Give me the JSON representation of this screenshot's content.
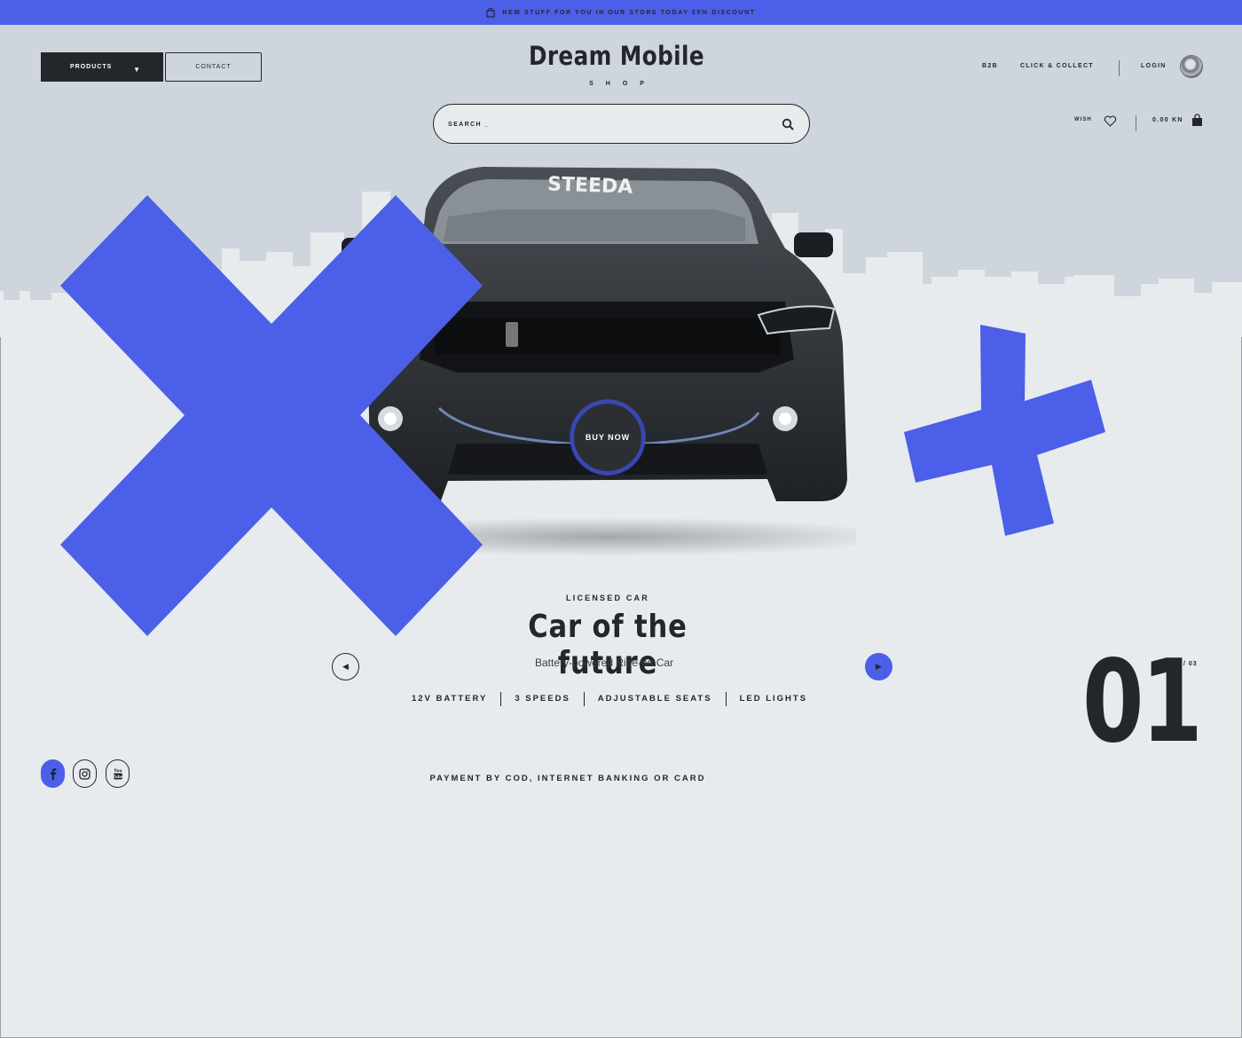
{
  "promo": {
    "text": "NEW STUFF FOR YOU IN OUR STORE TODAY 25% DISCOUNT",
    "icon": "bag-icon"
  },
  "header": {
    "products_label": "PRODUCTS",
    "contact_label": "CONTACT",
    "brand_title": "Dream Mobile",
    "brand_subtitle": "SHOP",
    "search_placeholder": "SEARCH _",
    "nav": {
      "b2b": "B2B",
      "click_collect": "CLICK & COLLECT",
      "login": "LOGIN"
    },
    "wish_label": "WISH",
    "cart_total": "0.00 KN"
  },
  "hero": {
    "buy_now_label": "BUY NOW",
    "eyebrow": "LICENSED CAR",
    "title": "Car of the future",
    "subtitle": "Battery-powered Ride-on Car",
    "features": [
      "12V BATTERY",
      "3 SPEEDS",
      "ADJUSTABLE SEATS",
      "LED LIGHTS"
    ],
    "slide_current": "01",
    "slide_total": "/ 03",
    "car_windshield_text": "STEEDA"
  },
  "footer": {
    "payment_text": "PAYMENT BY COD, INTERNET BANKING OR CARD",
    "social": [
      "facebook-icon",
      "instagram-icon",
      "youtube-icon"
    ],
    "youtube_text": "You Tube"
  },
  "colors": {
    "accent": "#4c5fe8",
    "dark": "#23272b",
    "bg": "#e7ebee",
    "band": "#cfd5dc",
    "skyline": "#e7ebee"
  }
}
